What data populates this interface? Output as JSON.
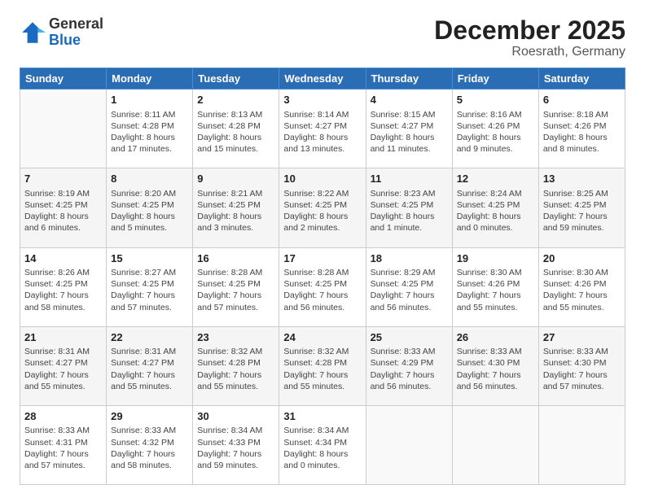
{
  "logo": {
    "general": "General",
    "blue": "Blue"
  },
  "title": "December 2025",
  "location": "Roesrath, Germany",
  "weekdays": [
    "Sunday",
    "Monday",
    "Tuesday",
    "Wednesday",
    "Thursday",
    "Friday",
    "Saturday"
  ],
  "weeks": [
    [
      {
        "day": "",
        "info": ""
      },
      {
        "day": "1",
        "info": "Sunrise: 8:11 AM\nSunset: 4:28 PM\nDaylight: 8 hours\nand 17 minutes."
      },
      {
        "day": "2",
        "info": "Sunrise: 8:13 AM\nSunset: 4:28 PM\nDaylight: 8 hours\nand 15 minutes."
      },
      {
        "day": "3",
        "info": "Sunrise: 8:14 AM\nSunset: 4:27 PM\nDaylight: 8 hours\nand 13 minutes."
      },
      {
        "day": "4",
        "info": "Sunrise: 8:15 AM\nSunset: 4:27 PM\nDaylight: 8 hours\nand 11 minutes."
      },
      {
        "day": "5",
        "info": "Sunrise: 8:16 AM\nSunset: 4:26 PM\nDaylight: 8 hours\nand 9 minutes."
      },
      {
        "day": "6",
        "info": "Sunrise: 8:18 AM\nSunset: 4:26 PM\nDaylight: 8 hours\nand 8 minutes."
      }
    ],
    [
      {
        "day": "7",
        "info": "Sunrise: 8:19 AM\nSunset: 4:25 PM\nDaylight: 8 hours\nand 6 minutes."
      },
      {
        "day": "8",
        "info": "Sunrise: 8:20 AM\nSunset: 4:25 PM\nDaylight: 8 hours\nand 5 minutes."
      },
      {
        "day": "9",
        "info": "Sunrise: 8:21 AM\nSunset: 4:25 PM\nDaylight: 8 hours\nand 3 minutes."
      },
      {
        "day": "10",
        "info": "Sunrise: 8:22 AM\nSunset: 4:25 PM\nDaylight: 8 hours\nand 2 minutes."
      },
      {
        "day": "11",
        "info": "Sunrise: 8:23 AM\nSunset: 4:25 PM\nDaylight: 8 hours\nand 1 minute."
      },
      {
        "day": "12",
        "info": "Sunrise: 8:24 AM\nSunset: 4:25 PM\nDaylight: 8 hours\nand 0 minutes."
      },
      {
        "day": "13",
        "info": "Sunrise: 8:25 AM\nSunset: 4:25 PM\nDaylight: 7 hours\nand 59 minutes."
      }
    ],
    [
      {
        "day": "14",
        "info": "Sunrise: 8:26 AM\nSunset: 4:25 PM\nDaylight: 7 hours\nand 58 minutes."
      },
      {
        "day": "15",
        "info": "Sunrise: 8:27 AM\nSunset: 4:25 PM\nDaylight: 7 hours\nand 57 minutes."
      },
      {
        "day": "16",
        "info": "Sunrise: 8:28 AM\nSunset: 4:25 PM\nDaylight: 7 hours\nand 57 minutes."
      },
      {
        "day": "17",
        "info": "Sunrise: 8:28 AM\nSunset: 4:25 PM\nDaylight: 7 hours\nand 56 minutes."
      },
      {
        "day": "18",
        "info": "Sunrise: 8:29 AM\nSunset: 4:25 PM\nDaylight: 7 hours\nand 56 minutes."
      },
      {
        "day": "19",
        "info": "Sunrise: 8:30 AM\nSunset: 4:26 PM\nDaylight: 7 hours\nand 55 minutes."
      },
      {
        "day": "20",
        "info": "Sunrise: 8:30 AM\nSunset: 4:26 PM\nDaylight: 7 hours\nand 55 minutes."
      }
    ],
    [
      {
        "day": "21",
        "info": "Sunrise: 8:31 AM\nSunset: 4:27 PM\nDaylight: 7 hours\nand 55 minutes."
      },
      {
        "day": "22",
        "info": "Sunrise: 8:31 AM\nSunset: 4:27 PM\nDaylight: 7 hours\nand 55 minutes."
      },
      {
        "day": "23",
        "info": "Sunrise: 8:32 AM\nSunset: 4:28 PM\nDaylight: 7 hours\nand 55 minutes."
      },
      {
        "day": "24",
        "info": "Sunrise: 8:32 AM\nSunset: 4:28 PM\nDaylight: 7 hours\nand 55 minutes."
      },
      {
        "day": "25",
        "info": "Sunrise: 8:33 AM\nSunset: 4:29 PM\nDaylight: 7 hours\nand 56 minutes."
      },
      {
        "day": "26",
        "info": "Sunrise: 8:33 AM\nSunset: 4:30 PM\nDaylight: 7 hours\nand 56 minutes."
      },
      {
        "day": "27",
        "info": "Sunrise: 8:33 AM\nSunset: 4:30 PM\nDaylight: 7 hours\nand 57 minutes."
      }
    ],
    [
      {
        "day": "28",
        "info": "Sunrise: 8:33 AM\nSunset: 4:31 PM\nDaylight: 7 hours\nand 57 minutes."
      },
      {
        "day": "29",
        "info": "Sunrise: 8:33 AM\nSunset: 4:32 PM\nDaylight: 7 hours\nand 58 minutes."
      },
      {
        "day": "30",
        "info": "Sunrise: 8:34 AM\nSunset: 4:33 PM\nDaylight: 7 hours\nand 59 minutes."
      },
      {
        "day": "31",
        "info": "Sunrise: 8:34 AM\nSunset: 4:34 PM\nDaylight: 8 hours\nand 0 minutes."
      },
      {
        "day": "",
        "info": ""
      },
      {
        "day": "",
        "info": ""
      },
      {
        "day": "",
        "info": ""
      }
    ]
  ]
}
